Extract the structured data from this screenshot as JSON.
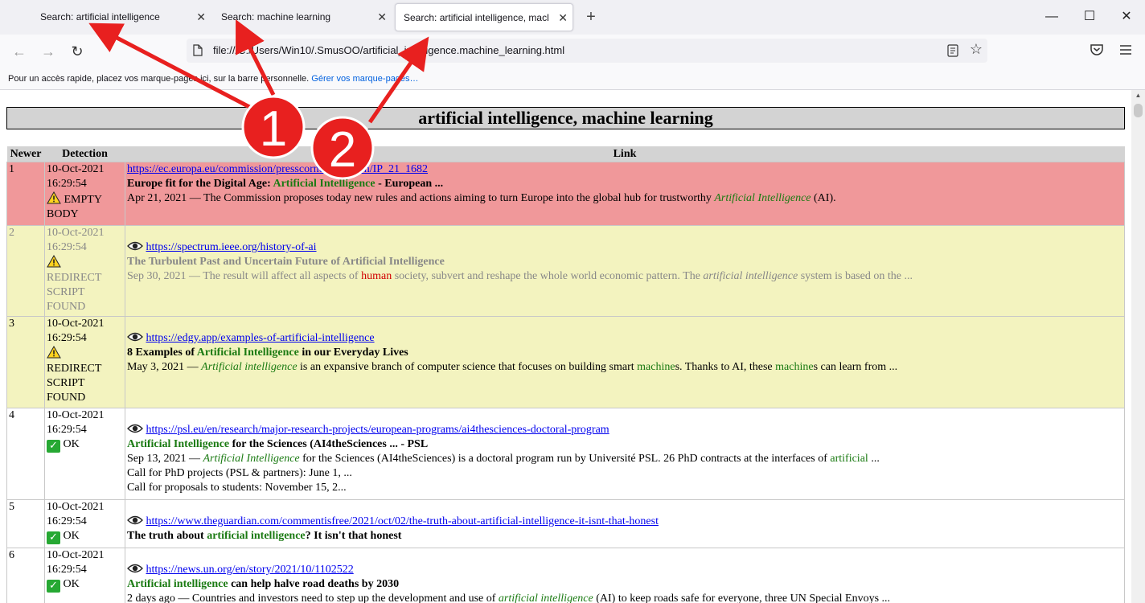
{
  "browser": {
    "tabs": [
      {
        "label": "Search: artificial intelligence"
      },
      {
        "label": "Search: machine learning"
      },
      {
        "label": "Search: artificial intelligence, machine learning"
      }
    ],
    "new_tab_icon": "plus-icon",
    "url": "file:///C:/Users/Win10/.SmusOO/artificial_intelligence.machine_learning.html",
    "bookmarks_text": "Pour un accès rapide, placez vos marque-pages ici, sur la barre personnelle.",
    "bookmarks_link": "Gérer vos marque-pages…"
  },
  "annotations": {
    "marker1": "1",
    "marker2": "2",
    "color": "#e8201f"
  },
  "page": {
    "heading": "artificial intelligence, machine learning",
    "columns": {
      "newer": "Newer",
      "detection": "Detection",
      "link": "Link"
    },
    "rows": [
      {
        "num": "1",
        "date": "10-Oct-2021",
        "time": "16:29:54",
        "status": "EMPTY BODY",
        "status_icon": "warning-icon",
        "url": "https://ec.europa.eu/commission/presscorner/detail/en/IP_21_1682",
        "title_pre": "Europe fit for the Digital Age: ",
        "title_kw": "Artificial Intelligence",
        "title_post": " - European ...",
        "snip_pre": "Apr 21, 2021 — The Commission proposes today new rules and actions aiming to turn Europe into the global hub for trustworthy ",
        "snip_kw": "Artificial Intelligence",
        "snip_post": " (AI)."
      },
      {
        "num": "2",
        "date": "10-Oct-2021",
        "time": "16:29:54",
        "status": "REDIRECT SCRIPT FOUND",
        "status_icon": "warning-icon",
        "url": "https://spectrum.ieee.org/history-of-ai",
        "title": "The Turbulent Past and Uncertain Future of Artificial Intelligence",
        "snip_pre": "Sep 30, 2021 — The result will affect all aspects of ",
        "snip_red": "human",
        "snip_mid": " society, subvert and reshape the whole world economic pattern. The ",
        "snip_kw": "artificial intelligence",
        "snip_post": " system is based on the ..."
      },
      {
        "num": "3",
        "date": "10-Oct-2021",
        "time": "16:29:54",
        "status": "REDIRECT SCRIPT FOUND",
        "status_icon": "warning-icon",
        "url": "https://edgy.app/examples-of-artificial-intelligence",
        "title_pre": "8 Examples of ",
        "title_kw": "Artificial Intelligence",
        "title_post": " in our Everyday Lives",
        "snip_pre": "May 3, 2021 — ",
        "snip_kw": "Artificial intelligence",
        "snip_mid": " is an expansive branch of computer science that focuses on building smart ",
        "snip_kw2": "machine",
        "snip_mid2": "s. Thanks to AI, these ",
        "snip_kw3": "machine",
        "snip_post": "s can learn from ..."
      },
      {
        "num": "4",
        "date": "10-Oct-2021",
        "time": "16:29:54",
        "status": "OK",
        "status_icon": "check-icon",
        "url": "https://psl.eu/en/research/major-research-projects/european-programs/ai4thesciences-doctoral-program",
        "title_kw": "Artificial Intelligence",
        "title_post": " for the Sciences (AI4theSciences ... - PSL",
        "snip_pre": "Sep 13, 2021 — ",
        "snip_kw": "Artificial Intelligence",
        "snip_mid": " for the Sciences (AI4theSciences) is a doctoral program run by Université PSL. 26 PhD contracts at the interfaces of ",
        "snip_kw2": "artificial",
        "snip_post": " ...",
        "extra1": "Call for PhD projects (PSL & partners): June 1, ...",
        "extra2": "Call for proposals to students: November 15, 2..."
      },
      {
        "num": "5",
        "date": "10-Oct-2021",
        "time": "16:29:54",
        "status": "OK",
        "status_icon": "check-icon",
        "url": "https://www.theguardian.com/commentisfree/2021/oct/02/the-truth-about-artificial-intelligence-it-isnt-that-honest",
        "title_pre": "The truth about ",
        "title_kw": "artificial intelligence",
        "title_post": "? It isn't that honest"
      },
      {
        "num": "6",
        "date": "10-Oct-2021",
        "time": "16:29:54",
        "status": "OK",
        "status_icon": "check-icon",
        "url": "https://news.un.org/en/story/2021/10/1102522",
        "title_kw": "Artificial intelligence",
        "title_post": " can help halve road deaths by 2030",
        "snip_pre": "2 days ago — Countries and investors need to step up the development and use of ",
        "snip_kw": "artificial intelligence",
        "snip_post": " (AI) to keep roads safe for everyone, three UN Special Envoys ..."
      }
    ]
  },
  "colors": {
    "error_row": "#f0989a",
    "warning_row": "#f3f3bf",
    "ok_row": "#ffffff",
    "keyword": "#1a7a12",
    "link": "#0000ee"
  }
}
